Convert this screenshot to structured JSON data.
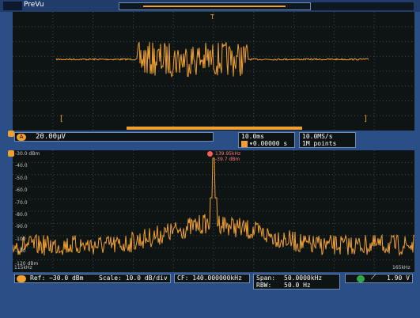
{
  "preview": {
    "label": "PreVu"
  },
  "colors": {
    "trace": "#f0a030",
    "background": "#0e1414",
    "frame": "#2a4f86",
    "grid": "#3c4848",
    "marker": "#ff5a5a"
  },
  "time_domain": {
    "channel_badge": "A",
    "scale": "20.00μV",
    "time_per_div": "10.0ms",
    "trigger_marker": "T",
    "trigger_delay": "▾0.00000 s",
    "sample_rate": "10.0MS/s",
    "record_length": "1M points",
    "bottom_left_bracket": "[",
    "bottom_right_bracket": "]"
  },
  "spectrum": {
    "ref_label": "Ref: −30.0 dBm",
    "scale_label": "Scale: 10.0 dB/div",
    "cf_label": "CF: 140.000000kHz",
    "span_label": "Span:",
    "span_value": "50.0000kHz",
    "rbw_label": "RBW:",
    "rbw_value": "50.0 Hz",
    "trigger_level": "1.90 V",
    "y_ticks": [
      "-30.0 dBm",
      "-40.0",
      "-50.0",
      "-60.0",
      "-70.0",
      "-80.0",
      "-90.0",
      "-100",
      "-110",
      "-120 dBm"
    ],
    "marker_freq": "139.95kHz",
    "marker_level": "-39.7 dBm",
    "corner_left": "115kHz",
    "corner_right": "165kHz"
  }
}
